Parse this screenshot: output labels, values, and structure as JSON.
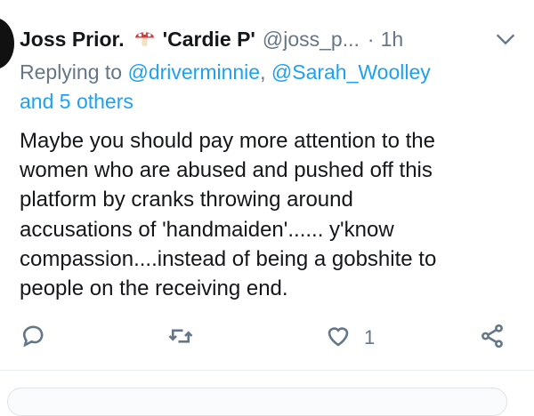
{
  "tweet": {
    "display_name": "Joss Prior.",
    "name_suffix": "'Cardie P'",
    "handle": "@joss_p...",
    "separator": "·",
    "time": "1h",
    "reply_prefix": "Replying to",
    "reply_user1": "@driverminnie",
    "reply_sep": ",",
    "reply_user2": "@Sarah_Woolley",
    "reply_rest": "and 5 others",
    "body_lines": [
      "Maybe you should pay more attention to the",
      "women who are abused and pushed off this",
      "platform by cranks throwing around",
      "accusations of 'handmaiden'...... y'know",
      "compassion....instead of being a gobshite to",
      "people on the receiving end."
    ],
    "likes": "1"
  },
  "icons": {
    "emoji": "mushroom-icon",
    "menu": "chevron-down-icon",
    "reply": "comment-icon",
    "retweet": "retweet-icon",
    "like": "heart-icon",
    "share": "share-icon"
  },
  "colors": {
    "link": "#1da1f2",
    "secondary": "#657786",
    "text": "#14171a"
  }
}
